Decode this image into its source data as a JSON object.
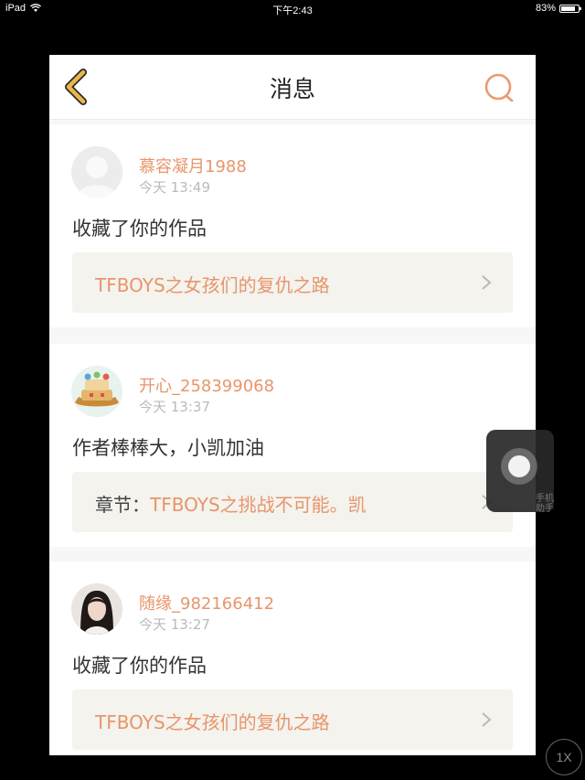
{
  "status_bar": {
    "device": "iPad",
    "time": "下午2:43",
    "battery": "83%",
    "battery_level": 0.83
  },
  "header": {
    "title": "消息"
  },
  "messages": [
    {
      "username": "慕容凝月1988",
      "time": "今天 13:49",
      "text": "收藏了你的作品",
      "ref_prefix": "",
      "ref_title": "TFBOYS之女孩们的复仇之路"
    },
    {
      "username": "开心_258399068",
      "time": "今天 13:37",
      "text": "作者棒棒大，小凯加油",
      "ref_prefix": "章节：",
      "ref_title": "TFBOYS之挑战不可能。凯"
    },
    {
      "username": "随缘_982166412",
      "time": "今天 13:27",
      "text": "收藏了你的作品",
      "ref_prefix": "",
      "ref_title": "TFBOYS之女孩们的复仇之路"
    }
  ],
  "overlay": {
    "assistive_label": "手机助手",
    "zoom_label": "1X"
  },
  "colors": {
    "accent": "#e8956a",
    "nav_back": "#e8b84b",
    "ref_background": "#f4f3ee"
  }
}
